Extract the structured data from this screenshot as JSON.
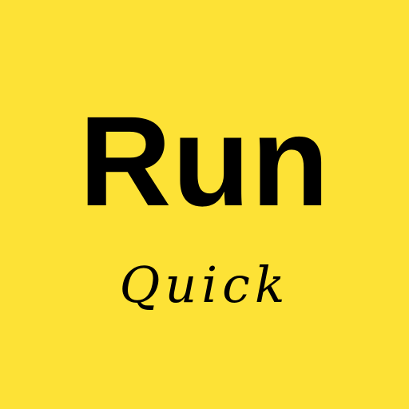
{
  "app": {
    "title": "Run",
    "subtitle": "Quick"
  },
  "colors": {
    "background": "#fde236",
    "text": "#000000"
  }
}
